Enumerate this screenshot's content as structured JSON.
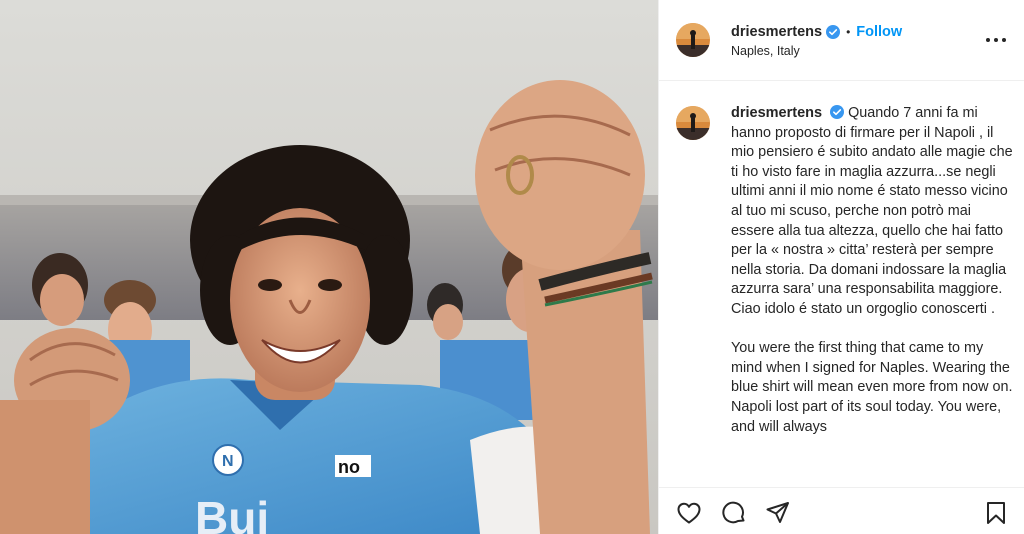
{
  "post": {
    "username": "driesmertens",
    "separator": "•",
    "follow_label": "Follow",
    "location": "Naples, Italy",
    "caption_paragraph_1": "Quando 7 anni fa mi hanno proposto di firmare per il Napoli , il mio pensiero é subito andato alle magie che ti ho visto fare in maglia azzurra...se negli ultimi anni il mio nome é stato messo vicino al tuo mi scuso, perche non potrò mai essere alla tua altezza, quello che hai fatto per la « nostra » citta’ resterà per sempre nella storia. Da domani indossare la maglia azzurra sara’ una responsabilita maggiore. Ciao idolo é stato un orgoglio conoscerti .",
    "caption_paragraph_2": "You were the first thing that came to my mind when I signed for Naples. Wearing the blue shirt will mean even more from now on. Napoli lost part of its soul today. You were, and will always"
  },
  "photo": {
    "jersey_text": "Bui"
  },
  "icons": {
    "verified": "verified-badge-icon",
    "more": "more-options-icon",
    "like": "heart-icon",
    "comment": "comment-bubble-icon",
    "share": "paper-plane-icon",
    "save": "bookmark-icon"
  },
  "colors": {
    "follow": "#0095f6",
    "verified": "#3897f0",
    "text": "#262626",
    "border": "#efefef"
  }
}
